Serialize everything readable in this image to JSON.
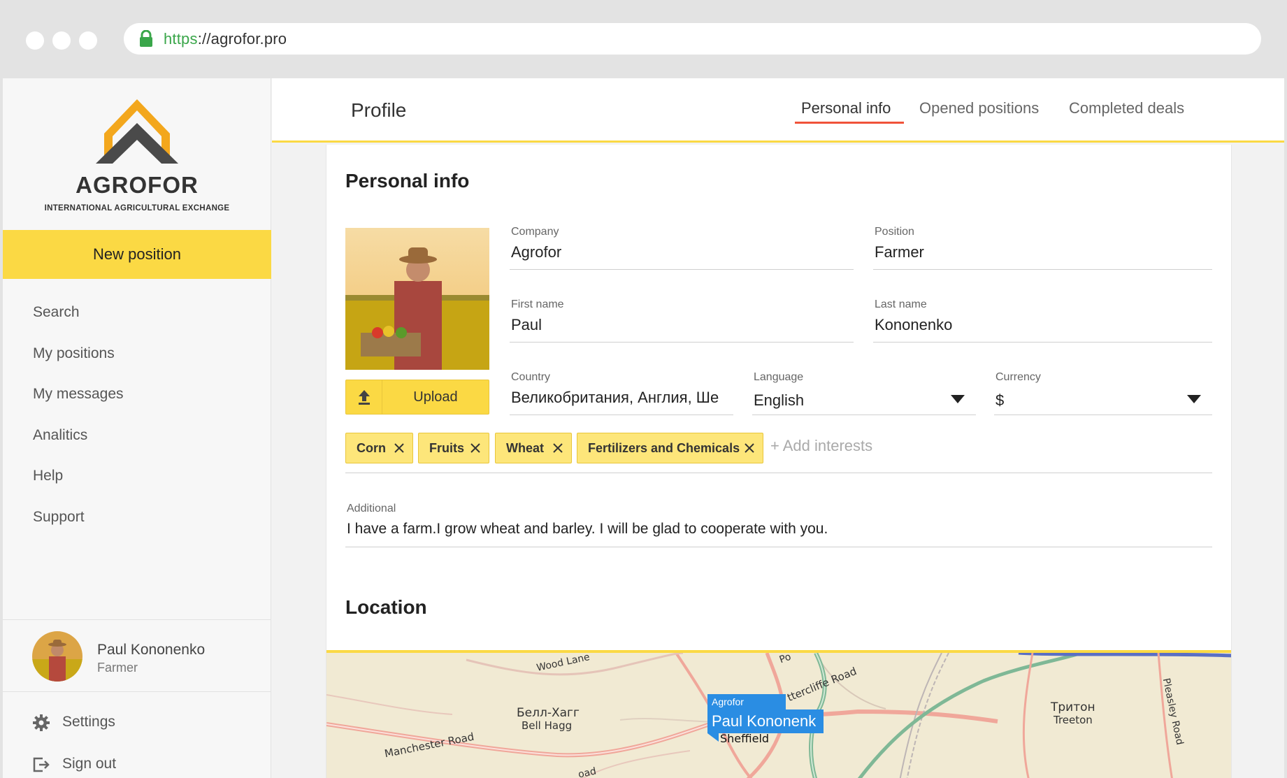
{
  "browser": {
    "url_protocol": "https",
    "url_rest": "://agrofor.pro"
  },
  "sidebar": {
    "logo_name": "AGROFOR",
    "logo_tagline": "INTERNATIONAL AGRICULTURAL EXCHANGE",
    "new_position_label": "New position",
    "nav": [
      {
        "label": "Search"
      },
      {
        "label": "My positions"
      },
      {
        "label": "My messages"
      },
      {
        "label": "Analitics"
      },
      {
        "label": "Help"
      },
      {
        "label": "Support"
      }
    ],
    "user": {
      "name": "Paul Kononenko",
      "role": "Farmer"
    },
    "settings_label": "Settings",
    "signout_label": "Sign out"
  },
  "header": {
    "title": "Profile",
    "tabs": [
      {
        "label": "Personal info",
        "active": true
      },
      {
        "label": "Opened positions",
        "active": false
      },
      {
        "label": "Completed deals",
        "active": false
      }
    ]
  },
  "personal": {
    "heading": "Personal info",
    "upload_label": "Upload",
    "company": {
      "label": "Company",
      "value": "Agrofor"
    },
    "position": {
      "label": "Position",
      "value": "Farmer"
    },
    "first_name": {
      "label": "First name",
      "value": "Paul"
    },
    "last_name": {
      "label": "Last name",
      "value": "Kononenko"
    },
    "country": {
      "label": "Country",
      "value": "Великобритания, Англия, Ше"
    },
    "language": {
      "label": "Language",
      "value": "English"
    },
    "currency": {
      "label": "Currency",
      "value": "$"
    },
    "interests": [
      "Corn",
      "Fruits",
      "Wheat",
      "Fertilizers and Chemicals"
    ],
    "add_interests_label": "+ Add interests",
    "additional": {
      "label": "Additional",
      "value": "I have a farm.I grow wheat and barley. I will be glad to cooperate with you."
    }
  },
  "location": {
    "heading": "Location",
    "map_labels": {
      "wood_lane": "Wood Lane",
      "bell_hagg_ru": "Белл-Хагг",
      "bell_hagg": "Bell Hagg",
      "manchester_road": "Manchester Road",
      "attercliffe": "ttercliffe Road",
      "sheffield": "Sheffield",
      "treeton_ru": "Тритон",
      "treeton": "Treeton",
      "pleasley": "Pleasley Road",
      "road_bottom": "oad",
      "po": "Po"
    },
    "pin_company": "Agrofor",
    "pin_name": "Paul Kononenk"
  },
  "colors": {
    "accent_yellow": "#fbd944",
    "tab_underline": "#f0533a",
    "pin_blue": "#2a8de3",
    "secure_green": "#3aa64a"
  }
}
